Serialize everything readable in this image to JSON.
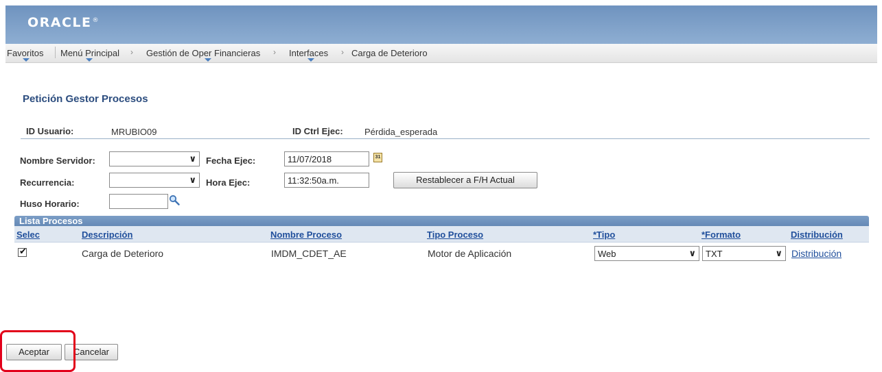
{
  "header": {
    "logo": "ORACLE",
    "logo_mark": "®"
  },
  "nav": {
    "items": [
      "Favoritos",
      "Menú Principal",
      "Gestión de Oper Financieras",
      "Interfaces",
      "Carga de Deterioro"
    ],
    "separator": "›"
  },
  "page": {
    "title": "Petición Gestor Procesos"
  },
  "form": {
    "id_usuario_label": "ID Usuario:",
    "id_usuario_value": "MRUBIO09",
    "id_ctrl_label": "ID Ctrl Ejec:",
    "id_ctrl_value": "Pérdida_esperada",
    "servidor_label": "Nombre Servidor:",
    "servidor_value": "",
    "recurrencia_label": "Recurrencia:",
    "recurrencia_value": "",
    "huso_label": "Huso Horario:",
    "huso_value": "",
    "fecha_label": "Fecha Ejec:",
    "fecha_value": "11/07/2018",
    "hora_label": "Hora Ejec:",
    "hora_value": "11:32:50a.m.",
    "reset_button": "Restablecer a F/H Actual",
    "calendar_icon_text": "31"
  },
  "grid": {
    "title": "Lista Procesos",
    "columns": [
      "Selec",
      "Descripción",
      "Nombre Proceso",
      "Tipo Proceso",
      "*Tipo",
      "*Formato",
      "Distribución"
    ],
    "rows": [
      {
        "selected": true,
        "descripcion": "Carga de Deterioro",
        "nombre_proceso": "IMDM_CDET_AE",
        "tipo_proceso": "Motor de Aplicación",
        "tipo": "Web",
        "formato": "TXT",
        "distribucion": "Distribución"
      }
    ]
  },
  "actions": {
    "accept": "Aceptar",
    "cancel": "Cancelar"
  },
  "colors": {
    "banner": "#7a9cc6",
    "link": "#1f4e9b",
    "highlight": "#e2001a"
  }
}
